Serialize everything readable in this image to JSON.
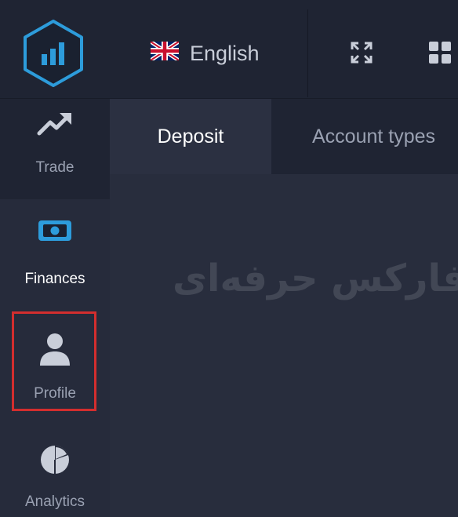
{
  "header": {
    "language": {
      "label": "English",
      "flag": "uk-flag-icon"
    }
  },
  "sidebar": {
    "items": [
      {
        "label": "Trade",
        "icon": "trend-up-icon"
      },
      {
        "label": "Finances",
        "icon": "banknote-icon"
      },
      {
        "label": "Profile",
        "icon": "user-icon"
      },
      {
        "label": "Analytics",
        "icon": "pie-chart-icon"
      }
    ]
  },
  "tabs": [
    {
      "label": "Deposit"
    },
    {
      "label": "Account types"
    }
  ],
  "watermark": {
    "text": "فارکس حرفه‌ای"
  },
  "colors": {
    "accent": "#2d9cdb",
    "highlight": "#d32e2e",
    "topbar": "#1f2433",
    "background": "#282d3d"
  }
}
